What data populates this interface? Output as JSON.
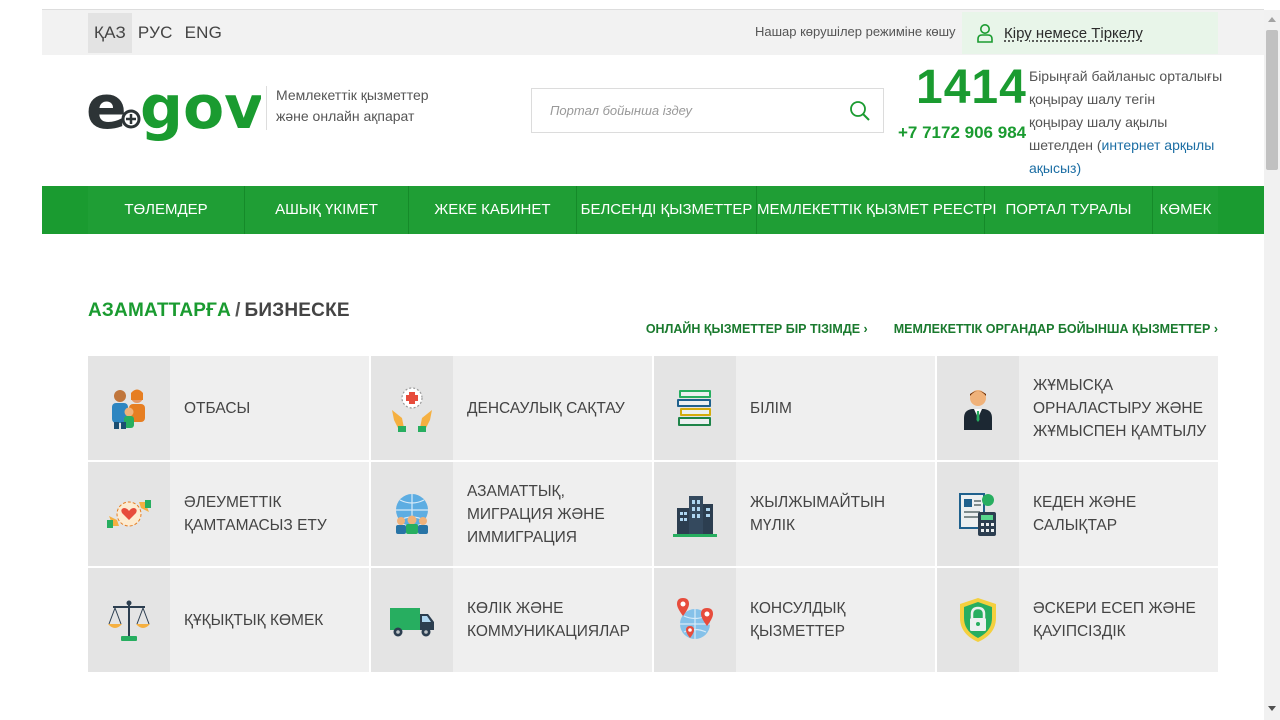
{
  "languages": [
    {
      "label": "ҚАЗ",
      "active": true
    },
    {
      "label": "РУС",
      "active": false
    },
    {
      "label": "ENG",
      "active": false
    }
  ],
  "topbar": {
    "low_vision": "Нашар көрушілер режиміне көшу",
    "login": "Кіру немесе Тіркелу"
  },
  "header": {
    "tagline_line1": "Мемлекеттік қызметтер",
    "tagline_line2": "және онлайн ақпарат",
    "search_placeholder": "Портал бойынша іздеу",
    "phone_short": "1414",
    "phone_long": "+7 7172 906 984",
    "contact_line1": "Бірыңғай байланыс орталығы",
    "contact_line2": "қоңырау шалу тегін",
    "contact_line3": "қоңырау шалу ақылы",
    "contact_line4_prefix": "шетелден (",
    "contact_link": "интернет арқылы",
    "contact_line5": "ақысыз)"
  },
  "nav": [
    {
      "label": "ТӨЛЕМДЕР"
    },
    {
      "label": "АШЫҚ ҮКІМЕТ"
    },
    {
      "label": "ЖЕКЕ КАБИНЕТ"
    },
    {
      "label": "БЕЛСЕНДІ ҚЫЗМЕТТЕР"
    },
    {
      "label": "МЕМЛЕКЕТТІК ҚЫЗМЕТ РЕЕСТРІ"
    },
    {
      "label": "ПОРТАЛ ТУРАЛЫ"
    },
    {
      "label": "КӨМЕК"
    }
  ],
  "section": {
    "title_citizens": "АЗАМАТТАРҒА",
    "title_sep": "/",
    "title_business": "БИЗНЕСКЕ",
    "link_online_list": "ОНЛАЙН ҚЫЗМЕТТЕР БІР ТІЗІМДЕ ›",
    "link_by_agency": "МЕМЛЕКЕТТІК ОРГАНДАР БОЙЫНША ҚЫЗМЕТТЕР ›"
  },
  "categories": [
    {
      "label": "ОТБАСЫ",
      "icon": "family-icon"
    },
    {
      "label": "ДЕНСАУЛЫҚ САҚТАУ",
      "icon": "healthcare-icon"
    },
    {
      "label": "БІЛІМ",
      "icon": "books-icon"
    },
    {
      "label": "ЖҰМЫСҚА ОРНАЛАСТЫРУ ЖӘНЕ ЖҰМЫСПЕН ҚАМТЫЛУ",
      "icon": "worker-icon"
    },
    {
      "label": "ӘЛЕУМЕТТІК ҚАМТАМАСЫЗ ЕТУ",
      "icon": "social-care-icon"
    },
    {
      "label": "АЗАМАТТЫҚ, МИГРАЦИЯ ЖӘНЕ ИММИГРАЦИЯ",
      "icon": "globe-people-icon"
    },
    {
      "label": "ЖЫЛЖЫМАЙТЫН МҮЛІК",
      "icon": "buildings-icon"
    },
    {
      "label": "КЕДЕН ЖӘНЕ САЛЫҚТАР",
      "icon": "tax-calculator-icon"
    },
    {
      "label": "ҚҰҚЫҚТЫҚ КӨМЕК",
      "icon": "scales-icon"
    },
    {
      "label": "КӨЛІК ЖӘНЕ КОММУНИКАЦИЯЛАР",
      "icon": "truck-icon"
    },
    {
      "label": "КОНСУЛДЫҚ ҚЫЗМЕТТЕР",
      "icon": "globe-pins-icon"
    },
    {
      "label": "ӘСКЕРИ ЕСЕП ЖӘНЕ ҚАУІПСІЗДІК",
      "icon": "shield-lock-icon"
    }
  ],
  "colors": {
    "brand_green": "#1a9b30",
    "nav_green": "#1f9e35",
    "link_blue": "#1c6ea4"
  }
}
